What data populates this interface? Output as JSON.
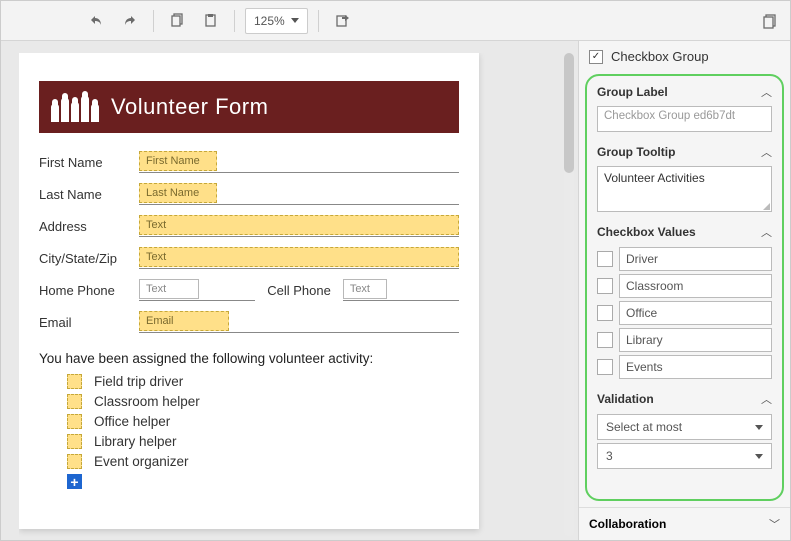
{
  "toolbar": {
    "zoom_value": "125%"
  },
  "form": {
    "banner_title": "Volunteer Form",
    "first_name_label": "First Name",
    "first_name_ph": "First Name",
    "last_name_label": "Last Name",
    "last_name_ph": "Last Name",
    "address_label": "Address",
    "address_ph": "Text",
    "csz_label": "City/State/Zip",
    "csz_ph": "Text",
    "home_phone_label": "Home Phone",
    "home_phone_ph": "Text",
    "cell_phone_label": "Cell Phone",
    "cell_phone_ph": "Text",
    "email_label": "Email",
    "email_ph": "Email",
    "assign_text": "You have been assigned the following volunteer activity:",
    "activities": [
      "Field trip driver",
      "Classroom helper",
      "Office helper",
      "Library helper",
      "Event organizer"
    ]
  },
  "panel": {
    "component_title": "Checkbox Group",
    "group_label_header": "Group Label",
    "group_label_placeholder": "Checkbox Group ed6b7dt",
    "group_tooltip_header": "Group Tooltip",
    "group_tooltip_value": "Volunteer Activities",
    "checkbox_values_header": "Checkbox Values",
    "checkbox_values": [
      "Driver",
      "Classroom",
      "Office",
      "Library",
      "Events"
    ],
    "validation_header": "Validation",
    "validation_rule": "Select at most",
    "validation_count": "3",
    "collaboration_header": "Collaboration"
  }
}
